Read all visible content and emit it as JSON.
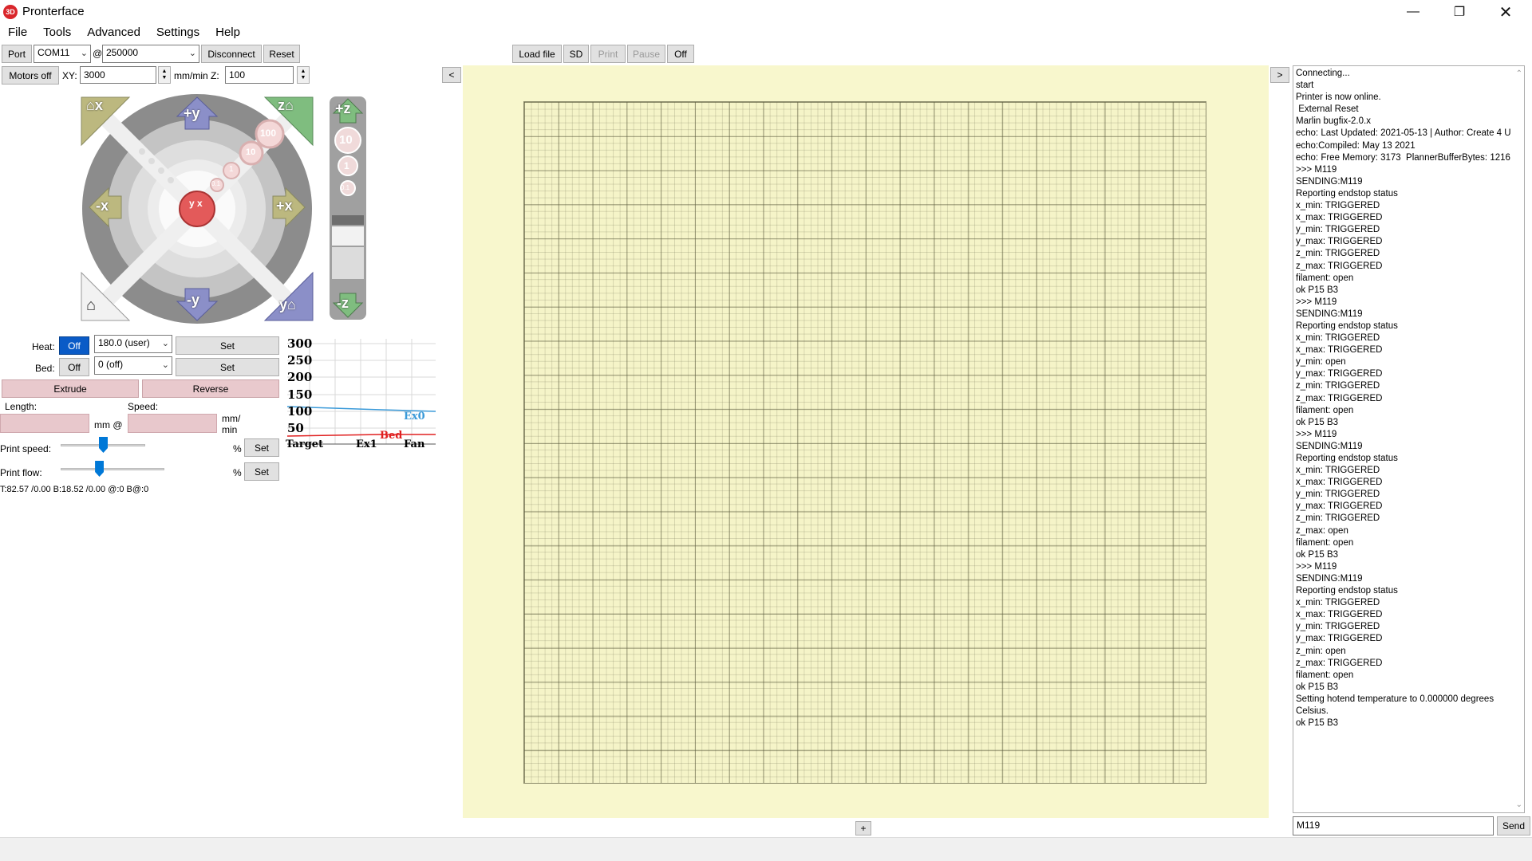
{
  "window": {
    "title": "Pronterface",
    "minimize_icon": "minimize-icon",
    "maximize_icon": "restore-icon",
    "close_icon": "close-icon"
  },
  "menu": [
    "File",
    "Tools",
    "Advanced",
    "Settings",
    "Help"
  ],
  "toolbar": {
    "port_label": "Port",
    "port_value": "COM11",
    "at": "@",
    "baud_value": "250000",
    "disconnect_label": "Disconnect",
    "reset_label": "Reset",
    "motors_off_label": "Motors off",
    "xy_label": "XY:",
    "xy_value": "3000",
    "mmmin_label": "mm/min Z:",
    "z_value": "100",
    "load_file_label": "Load file",
    "sd_label": "SD",
    "print_label": "Print",
    "pause_label": "Pause",
    "off_label": "Off",
    "collapse_left_label": "<",
    "collapse_right_label": ">"
  },
  "jog": {
    "home_x": "x",
    "plus_y": "+y",
    "home_z": "z",
    "minus_x": "-x",
    "plus_x": "+x",
    "minus_y": "-y",
    "home_y": "y",
    "steps": [
      "100",
      "10",
      "1",
      "0.1"
    ],
    "center_label": "y x",
    "z_plus": "+z",
    "z_minus": "-z",
    "z_steps": [
      "10",
      "1",
      "0.1"
    ]
  },
  "temp": {
    "heat_label": "Heat:",
    "heat_toggle": "Off",
    "heat_value": "180.0 (user)",
    "heat_set": "Set",
    "bed_label": "Bed:",
    "bed_toggle": "Off",
    "bed_value": "0 (off)",
    "bed_set": "Set",
    "extrude_label": "Extrude",
    "reverse_label": "Reverse",
    "length_label": "Length:",
    "speed_label": "Speed:",
    "mm_at": "mm @",
    "mmmin": "mm/\nmin",
    "print_speed_label": "Print speed:",
    "print_flow_label": "Print flow:",
    "percent": "%",
    "set": "Set",
    "print_speed_value": 0.5,
    "print_flow_value": 0.37,
    "status_text": "T:82.57 /0.00 B:18.52 /0.00 @:0 B@:0"
  },
  "graph": {
    "y_ticks": [
      "300",
      "250",
      "200",
      "150",
      "100",
      "50"
    ],
    "labels": {
      "ex0": "Ex0",
      "bed": "Bed",
      "target": "Target",
      "ex1": "Ex1",
      "fan": "Fan"
    },
    "colors": {
      "ex0": "#3a9ad9",
      "bed": "#e02020"
    }
  },
  "log": {
    "lines": [
      "Connecting...",
      "start",
      "Printer is now online.",
      " External Reset",
      "Marlin bugfix-2.0.x",
      "echo: Last Updated: 2021-05-13 | Author: Create 4 U",
      "echo:Compiled: May 13 2021",
      "echo: Free Memory: 3173  PlannerBufferBytes: 1216",
      ">>> M119",
      "SENDING:M119",
      "Reporting endstop status",
      "x_min: TRIGGERED",
      "x_max: TRIGGERED",
      "y_min: TRIGGERED",
      "y_max: TRIGGERED",
      "z_min: TRIGGERED",
      "z_max: TRIGGERED",
      "filament: open",
      "ok P15 B3",
      ">>> M119",
      "SENDING:M119",
      "Reporting endstop status",
      "x_min: TRIGGERED",
      "x_max: TRIGGERED",
      "y_min: open",
      "y_max: TRIGGERED",
      "z_min: TRIGGERED",
      "z_max: TRIGGERED",
      "filament: open",
      "ok P15 B3",
      ">>> M119",
      "SENDING:M119",
      "Reporting endstop status",
      "x_min: TRIGGERED",
      "x_max: TRIGGERED",
      "y_min: TRIGGERED",
      "y_max: TRIGGERED",
      "z_min: TRIGGERED",
      "z_max: open",
      "filament: open",
      "ok P15 B3",
      ">>> M119",
      "SENDING:M119",
      "Reporting endstop status",
      "x_min: TRIGGERED",
      "x_max: TRIGGERED",
      "y_min: TRIGGERED",
      "y_max: TRIGGERED",
      "z_min: open",
      "z_max: TRIGGERED",
      "filament: open",
      "ok P15 B3",
      "Setting hotend temperature to 0.000000 degrees Celsius.",
      "ok P15 B3"
    ],
    "command_value": "M119",
    "send_label": "Send"
  },
  "canvas": {
    "add_label": "+"
  }
}
